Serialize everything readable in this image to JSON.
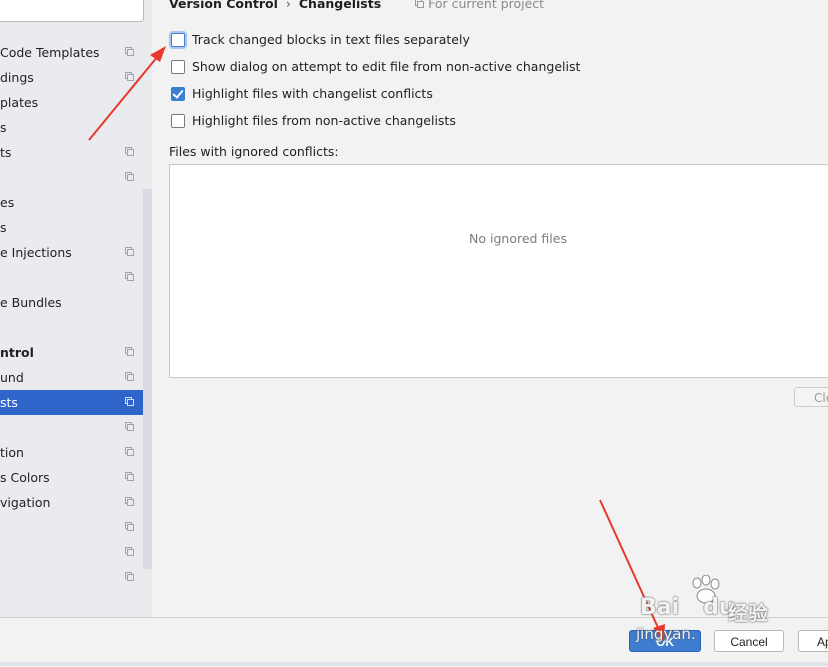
{
  "sidebar": {
    "items": [
      {
        "label": "Code Templates",
        "project_icon": true
      },
      {
        "label": "dings",
        "project_icon": true
      },
      {
        "label": "plates",
        "project_icon": false
      },
      {
        "label": "s",
        "project_icon": false
      },
      {
        "label": "ts",
        "project_icon": true
      },
      {
        "label": "",
        "project_icon": true
      },
      {
        "label": "es",
        "project_icon": false
      },
      {
        "label": "s",
        "project_icon": false
      },
      {
        "label": "e Injections",
        "project_icon": true
      },
      {
        "label": "",
        "project_icon": true
      },
      {
        "label": "e Bundles",
        "project_icon": false
      },
      {
        "label": "",
        "project_icon": false
      },
      {
        "label": "ntrol",
        "project_icon": true,
        "bold": true
      },
      {
        "label": "und",
        "project_icon": true
      },
      {
        "label": "sts",
        "project_icon": true,
        "selected": true
      },
      {
        "label": "",
        "project_icon": true
      },
      {
        "label": "tion",
        "project_icon": true
      },
      {
        "label": "s Colors",
        "project_icon": true
      },
      {
        "label": "vigation",
        "project_icon": true
      },
      {
        "label": "",
        "project_icon": true
      },
      {
        "label": "",
        "project_icon": true
      },
      {
        "label": "",
        "project_icon": true
      }
    ]
  },
  "breadcrumb": {
    "section": "Version Control",
    "separator": "›",
    "page": "Changelists",
    "scope": "For current project"
  },
  "options": [
    {
      "label": "Track changed blocks in text files separately",
      "checked": false,
      "focused": true
    },
    {
      "label": "Show dialog on attempt to edit file from non-active changelist",
      "checked": false,
      "focused": false
    },
    {
      "label": "Highlight files with changelist conflicts",
      "checked": true,
      "focused": false
    },
    {
      "label": "Highlight files from non-active changelists",
      "checked": false,
      "focused": false
    }
  ],
  "ignored": {
    "label": "Files with ignored conflicts:",
    "empty_text": "No ignored files",
    "clear_label": "Cle"
  },
  "footer": {
    "ok_label": "OK",
    "cancel_label": "Cancel",
    "apply_label": "Ap"
  },
  "watermark": {
    "brand": "Bai",
    "brand2": "du",
    "cn": "经验",
    "sub": "jingyan."
  },
  "colors": {
    "selection": "#2f65ca",
    "checkbox_checked": "#3b7fd3",
    "ok_button": "#3f7dd1",
    "annotation_arrow": "#e8392b"
  }
}
